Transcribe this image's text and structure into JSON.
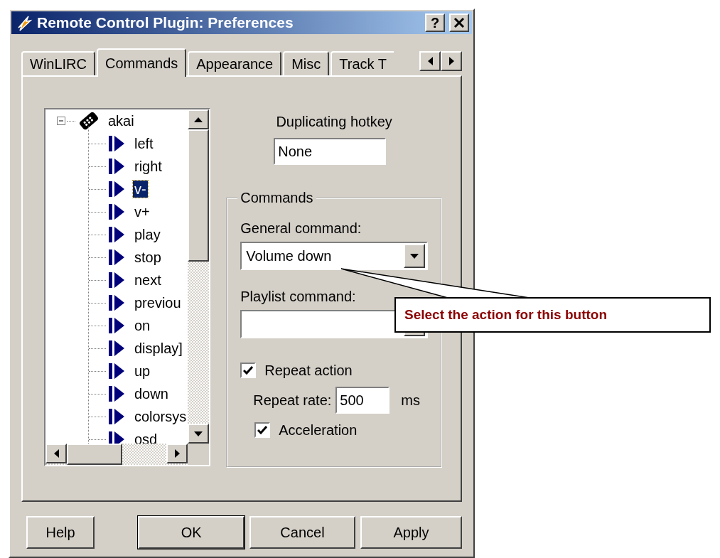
{
  "window": {
    "title": "Remote Control Plugin: Preferences",
    "help_button": "?"
  },
  "tabs": [
    {
      "label": "WinLIRC",
      "selected": false
    },
    {
      "label": "Commands",
      "selected": true
    },
    {
      "label": "Appearance",
      "selected": false
    },
    {
      "label": "Misc",
      "selected": false
    },
    {
      "label": "Track T",
      "selected": false
    }
  ],
  "tree": {
    "items": [
      {
        "label": "akai",
        "expanded": true,
        "children": [
          {
            "label": "left",
            "selected": false
          },
          {
            "label": "right",
            "selected": false
          },
          {
            "label": "v-",
            "selected": true
          },
          {
            "label": "v+",
            "selected": false
          },
          {
            "label": "play",
            "selected": false
          },
          {
            "label": "stop",
            "selected": false
          },
          {
            "label": "next",
            "selected": false
          },
          {
            "label": "previou",
            "selected": false
          },
          {
            "label": "on",
            "selected": false
          },
          {
            "label": "display]",
            "selected": false
          },
          {
            "label": "up",
            "selected": false
          },
          {
            "label": "down",
            "selected": false
          },
          {
            "label": "colorsys",
            "selected": false
          },
          {
            "label": "osd",
            "selected": false
          }
        ]
      }
    ]
  },
  "hotkey": {
    "label": "Duplicating hotkey",
    "value": "None"
  },
  "commands_group": {
    "title": "Commands",
    "general_label": "General command:",
    "general_value": "Volume down",
    "playlist_label": "Playlist command:",
    "repeat_action": {
      "label": "Repeat action",
      "checked": true
    },
    "repeat_rate": {
      "label": "Repeat rate:",
      "value": "500",
      "unit": "ms"
    },
    "acceleration": {
      "label": "Acceleration",
      "checked": true
    }
  },
  "buttons": [
    {
      "label": "Help",
      "default": false
    },
    {
      "label": "OK",
      "default": true
    },
    {
      "label": "Cancel",
      "default": false
    },
    {
      "label": "Apply",
      "default": false
    }
  ],
  "callout": {
    "text": "Select the action for this button"
  }
}
